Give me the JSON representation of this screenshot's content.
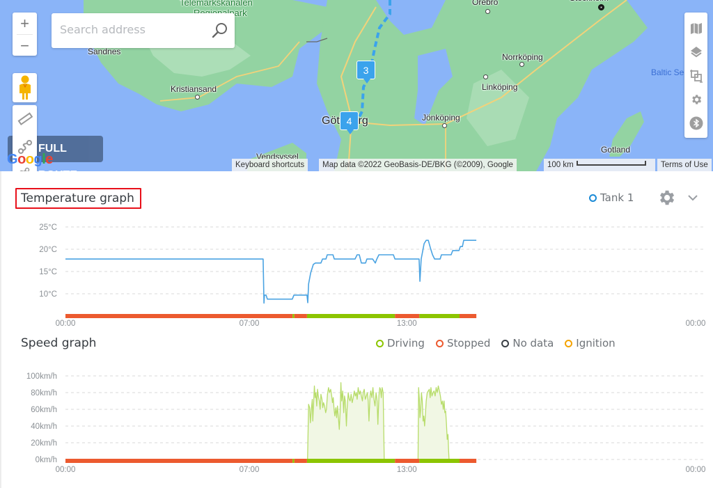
{
  "map": {
    "search": {
      "placeholder": "Search address",
      "value": ""
    },
    "zoom_in_label": "+",
    "zoom_out_label": "−",
    "full_route_label": "FULL ROUTE",
    "google_logo": [
      "G",
      "o",
      "o",
      "g",
      "l",
      "e"
    ],
    "places": [
      {
        "name": "Telemarkskanalen",
        "kind": "park"
      },
      {
        "name": "Regionalpark",
        "kind": "park"
      },
      {
        "name": "Sandnes",
        "kind": "city"
      },
      {
        "name": "Kristiansand",
        "kind": "city"
      },
      {
        "name": "Örebro",
        "kind": "city"
      },
      {
        "name": "Stockholm",
        "kind": "capital"
      },
      {
        "name": "Norrköping",
        "kind": "city"
      },
      {
        "name": "Linköping",
        "kind": "city"
      },
      {
        "name": "Jönköping",
        "kind": "city"
      },
      {
        "name": "Göteborg",
        "kind": "city"
      },
      {
        "name": "Vendsyssel",
        "kind": "city"
      },
      {
        "name": "Gotland",
        "kind": "city"
      },
      {
        "name": "Baltic Sea",
        "kind": "water"
      }
    ],
    "markers": [
      {
        "label": "3"
      },
      {
        "label": "4"
      }
    ],
    "right_controls": [
      "map-type-icon",
      "layers-icon",
      "fit-bounds-icon",
      "settings-icon",
      "bluetooth-icon"
    ],
    "left_tools": [
      "pegman-icon",
      "ruler-icon",
      "route-icon",
      "polygon-icon"
    ],
    "attribution": {
      "keyboard_shortcuts": "Keyboard shortcuts",
      "map_data": "Map data ©2022 GeoBasis-DE/BKG (©2009), Google",
      "scale": "100 km",
      "terms": "Terms of Use"
    }
  },
  "temperature": {
    "title": "Temperature graph",
    "legend": [
      {
        "label": "Tank 1",
        "color": "#1a8ad6"
      }
    ]
  },
  "speed": {
    "title": "Speed graph",
    "legend": [
      {
        "label": "Driving",
        "color": "#8cc500"
      },
      {
        "label": "Stopped",
        "color": "#ec5a2f"
      },
      {
        "label": "No data",
        "color": "#3a3f45"
      },
      {
        "label": "Ignition",
        "color": "#f5a300"
      }
    ]
  },
  "colors": {
    "temp_line": "#4aa3e2",
    "driving": "#8cc500",
    "stopped": "#ec5a2f",
    "speed_line": "#b7dc6a",
    "speed_fill": "#f1f7e4",
    "grid": "#d9d9d9"
  },
  "chart_data": [
    {
      "type": "line",
      "title": "Temperature graph",
      "xlabel": "",
      "ylabel": "",
      "x_unit": "hours",
      "xlim": [
        0,
        24
      ],
      "ylim": [
        5,
        25
      ],
      "y_ticks": [
        {
          "value": 25,
          "label": "25°C"
        },
        {
          "value": 20,
          "label": "20°C"
        },
        {
          "value": 15,
          "label": "15°C"
        },
        {
          "value": 10,
          "label": "10°C"
        }
      ],
      "x_ticks": [
        {
          "value": 0,
          "label": "00:00"
        },
        {
          "value": 7,
          "label": "07:00"
        },
        {
          "value": 13,
          "label": "13:00"
        },
        {
          "value": 24,
          "label": "00:00"
        }
      ],
      "grid": true,
      "legend_position": "top-right",
      "series": [
        {
          "name": "Tank 1",
          "points": [
            [
              0.0,
              17.8
            ],
            [
              7.53,
              17.8
            ],
            [
              7.56,
              7.9
            ],
            [
              7.58,
              9.7
            ],
            [
              7.64,
              9.7
            ],
            [
              7.69,
              8.8
            ],
            [
              8.64,
              8.8
            ],
            [
              8.7,
              9.7
            ],
            [
              9.2,
              9.7
            ],
            [
              9.23,
              8.0
            ],
            [
              9.26,
              12.2
            ],
            [
              9.34,
              14.7
            ],
            [
              9.44,
              16.6
            ],
            [
              9.52,
              16.9
            ],
            [
              9.73,
              16.9
            ],
            [
              9.79,
              17.8
            ],
            [
              9.92,
              17.8
            ],
            [
              9.97,
              18.75
            ],
            [
              10.19,
              18.75
            ],
            [
              10.24,
              17.8
            ],
            [
              11.03,
              17.8
            ],
            [
              11.11,
              18.75
            ],
            [
              11.19,
              18.75
            ],
            [
              11.27,
              16.9
            ],
            [
              11.43,
              16.9
            ],
            [
              11.48,
              17.8
            ],
            [
              11.7,
              17.8
            ],
            [
              11.8,
              16.9
            ],
            [
              11.86,
              17.8
            ],
            [
              11.94,
              18.75
            ],
            [
              12.49,
              18.75
            ],
            [
              12.55,
              17.8
            ],
            [
              13.47,
              17.8
            ],
            [
              13.5,
              12.8
            ],
            [
              13.55,
              17.8
            ],
            [
              13.66,
              21.25
            ],
            [
              13.74,
              22.0
            ],
            [
              13.82,
              22.0
            ],
            [
              13.9,
              20.3
            ],
            [
              13.98,
              18.75
            ],
            [
              14.06,
              17.8
            ],
            [
              14.27,
              17.8
            ],
            [
              14.32,
              18.75
            ],
            [
              14.69,
              18.75
            ],
            [
              14.75,
              19.7
            ],
            [
              14.99,
              19.7
            ],
            [
              15.04,
              20.6
            ],
            [
              15.12,
              20.6
            ],
            [
              15.17,
              22.0
            ],
            [
              15.65,
              22.0
            ]
          ]
        }
      ],
      "status_bar": [
        {
          "from": 0.0,
          "to": 8.65,
          "state": "Stopped"
        },
        {
          "from": 8.65,
          "to": 8.72,
          "state": "Driving"
        },
        {
          "from": 8.72,
          "to": 9.2,
          "state": "Stopped"
        },
        {
          "from": 9.2,
          "to": 12.55,
          "state": "Driving"
        },
        {
          "from": 12.55,
          "to": 13.48,
          "state": "Stopped"
        },
        {
          "from": 13.48,
          "to": 15.01,
          "state": "Driving"
        },
        {
          "from": 15.01,
          "to": 15.65,
          "state": "Stopped"
        }
      ]
    },
    {
      "type": "area",
      "title": "Speed graph",
      "xlabel": "",
      "ylabel": "",
      "x_unit": "hours",
      "xlim": [
        0,
        24
      ],
      "ylim": [
        0,
        100
      ],
      "y_ticks": [
        {
          "value": 100,
          "label": "100km/h"
        },
        {
          "value": 80,
          "label": "80km/h"
        },
        {
          "value": 60,
          "label": "60km/h"
        },
        {
          "value": 40,
          "label": "40km/h"
        },
        {
          "value": 20,
          "label": "20km/h"
        },
        {
          "value": 0,
          "label": "0km/h"
        }
      ],
      "x_ticks": [
        {
          "value": 0,
          "label": "00:00"
        },
        {
          "value": 7,
          "label": "07:00"
        },
        {
          "value": 13,
          "label": "13:00"
        },
        {
          "value": 24,
          "label": "00:00"
        }
      ],
      "grid": true,
      "legend_position": "top-right",
      "series": [
        {
          "name": "Driving",
          "points": [
            [
              9.22,
              0
            ],
            [
              9.26,
              66
            ],
            [
              9.3,
              62
            ],
            [
              9.33,
              44
            ],
            [
              9.36,
              58
            ],
            [
              9.4,
              72
            ],
            [
              9.42,
              46
            ],
            [
              9.45,
              66
            ],
            [
              9.48,
              88
            ],
            [
              9.51,
              74
            ],
            [
              9.54,
              80
            ],
            [
              9.57,
              64
            ],
            [
              9.6,
              84
            ],
            [
              9.63,
              76
            ],
            [
              9.67,
              70
            ],
            [
              9.7,
              60
            ],
            [
              9.73,
              78
            ],
            [
              9.77,
              72
            ],
            [
              9.8,
              62
            ],
            [
              9.83,
              68
            ],
            [
              9.87,
              64
            ],
            [
              9.91,
              56
            ],
            [
              9.94,
              60
            ],
            [
              9.98,
              78
            ],
            [
              10.02,
              86
            ],
            [
              10.06,
              80
            ],
            [
              10.1,
              84
            ],
            [
              10.14,
              76
            ],
            [
              10.17,
              68
            ],
            [
              10.2,
              74
            ],
            [
              10.23,
              60
            ],
            [
              10.26,
              52
            ],
            [
              10.3,
              62
            ],
            [
              10.33,
              50
            ],
            [
              10.36,
              64
            ],
            [
              10.4,
              48
            ],
            [
              10.43,
              36
            ],
            [
              10.46,
              56
            ],
            [
              10.49,
              92
            ],
            [
              10.52,
              70
            ],
            [
              10.56,
              82
            ],
            [
              10.6,
              56
            ],
            [
              10.63,
              76
            ],
            [
              10.66,
              70
            ],
            [
              10.7,
              40
            ],
            [
              10.73,
              62
            ],
            [
              10.77,
              80
            ],
            [
              10.81,
              72
            ],
            [
              10.84,
              70
            ],
            [
              10.88,
              78
            ],
            [
              10.92,
              68
            ],
            [
              10.96,
              74
            ],
            [
              11.0,
              82
            ],
            [
              11.04,
              76
            ],
            [
              11.08,
              80
            ],
            [
              11.11,
              72
            ],
            [
              11.15,
              86
            ],
            [
              11.19,
              78
            ],
            [
              11.23,
              82
            ],
            [
              11.27,
              76
            ],
            [
              11.31,
              70
            ],
            [
              11.34,
              80
            ],
            [
              11.38,
              84
            ],
            [
              11.42,
              72
            ],
            [
              11.46,
              76
            ],
            [
              11.5,
              80
            ],
            [
              11.53,
              70
            ],
            [
              11.56,
              46
            ],
            [
              11.6,
              76
            ],
            [
              11.63,
              82
            ],
            [
              11.67,
              74
            ],
            [
              11.71,
              86
            ],
            [
              11.75,
              72
            ],
            [
              11.79,
              64
            ],
            [
              11.83,
              80
            ],
            [
              11.87,
              70
            ],
            [
              11.9,
              42
            ],
            [
              11.94,
              76
            ],
            [
              11.97,
              86
            ],
            [
              12.0,
              84
            ],
            [
              12.03,
              74
            ],
            [
              12.06,
              86
            ],
            [
              12.1,
              80
            ],
            [
              12.14,
              0
            ],
            [
              13.43,
              0
            ],
            [
              13.45,
              86
            ],
            [
              13.48,
              72
            ],
            [
              13.5,
              50
            ],
            [
              13.53,
              60
            ],
            [
              13.56,
              80
            ],
            [
              13.59,
              70
            ],
            [
              13.62,
              46
            ],
            [
              13.65,
              52
            ],
            [
              13.68,
              40
            ],
            [
              13.71,
              54
            ],
            [
              13.74,
              70
            ],
            [
              13.78,
              80
            ],
            [
              13.82,
              82
            ],
            [
              13.86,
              84
            ],
            [
              13.89,
              74
            ],
            [
              13.92,
              86
            ],
            [
              13.96,
              76
            ],
            [
              14.0,
              80
            ],
            [
              14.04,
              82
            ],
            [
              14.08,
              76
            ],
            [
              14.12,
              86
            ],
            [
              14.16,
              80
            ],
            [
              14.2,
              88
            ],
            [
              14.24,
              82
            ],
            [
              14.28,
              76
            ],
            [
              14.32,
              66
            ],
            [
              14.36,
              70
            ],
            [
              14.39,
              60
            ],
            [
              14.42,
              70
            ],
            [
              14.45,
              56
            ],
            [
              14.48,
              58
            ],
            [
              14.51,
              44
            ],
            [
              14.54,
              24
            ],
            [
              14.57,
              30
            ],
            [
              14.59,
              12
            ],
            [
              14.61,
              0
            ]
          ]
        }
      ],
      "status_bar": [
        {
          "from": 0.0,
          "to": 8.65,
          "state": "Stopped"
        },
        {
          "from": 8.65,
          "to": 8.72,
          "state": "Driving"
        },
        {
          "from": 8.72,
          "to": 9.2,
          "state": "Stopped"
        },
        {
          "from": 9.2,
          "to": 12.55,
          "state": "Driving"
        },
        {
          "from": 12.55,
          "to": 13.48,
          "state": "Stopped"
        },
        {
          "from": 13.48,
          "to": 15.01,
          "state": "Driving"
        },
        {
          "from": 15.01,
          "to": 15.65,
          "state": "Stopped"
        }
      ]
    }
  ]
}
